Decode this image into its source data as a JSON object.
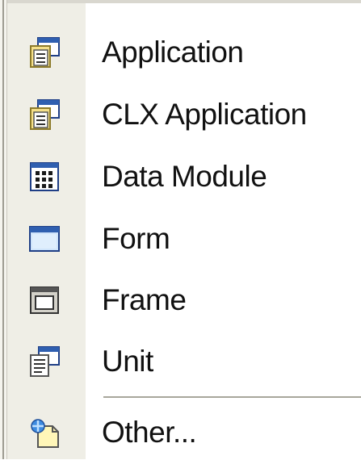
{
  "menu": {
    "items": [
      {
        "label": "Application",
        "icon": "application-icon"
      },
      {
        "label": "CLX Application",
        "icon": "clx-application-icon"
      },
      {
        "label": "Data Module",
        "icon": "data-module-icon"
      },
      {
        "label": "Form",
        "icon": "form-icon"
      },
      {
        "label": "Frame",
        "icon": "frame-icon"
      },
      {
        "label": "Unit",
        "icon": "unit-icon"
      },
      {
        "label": "Other...",
        "icon": "other-icon"
      }
    ]
  },
  "colors": {
    "gutter": "#efeee6",
    "accent_blue": "#2f5fb0",
    "text": "#111111"
  }
}
